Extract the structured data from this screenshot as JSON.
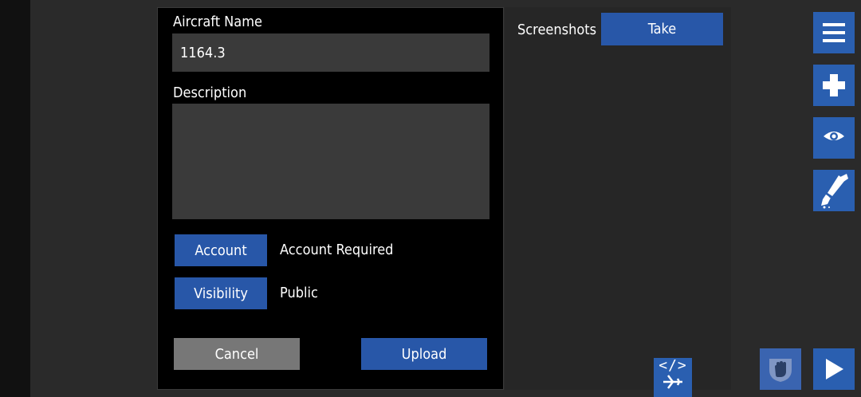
{
  "form": {
    "aircraft_name_label": "Aircraft Name",
    "aircraft_name_value": "1164.3",
    "description_label": "Description",
    "description_value": "",
    "account_button": "Account",
    "account_status": "Account Required",
    "visibility_button": "Visibility",
    "visibility_value": "Public",
    "cancel_button": "Cancel",
    "upload_button": "Upload"
  },
  "screenshots": {
    "label": "Screenshots",
    "take_button": "Take"
  },
  "toolbar": {
    "icons": [
      "menu-icon",
      "add-part-icon",
      "view-icon",
      "paint-icon",
      "hand-icon",
      "play-icon",
      "code-aircraft-icon"
    ],
    "code_glyph": "</>"
  },
  "colors": {
    "accent_blue": "#2857a8",
    "cancel_gray": "#777777",
    "field_bg": "#3a3a3a",
    "dialog_bg": "#000000"
  }
}
